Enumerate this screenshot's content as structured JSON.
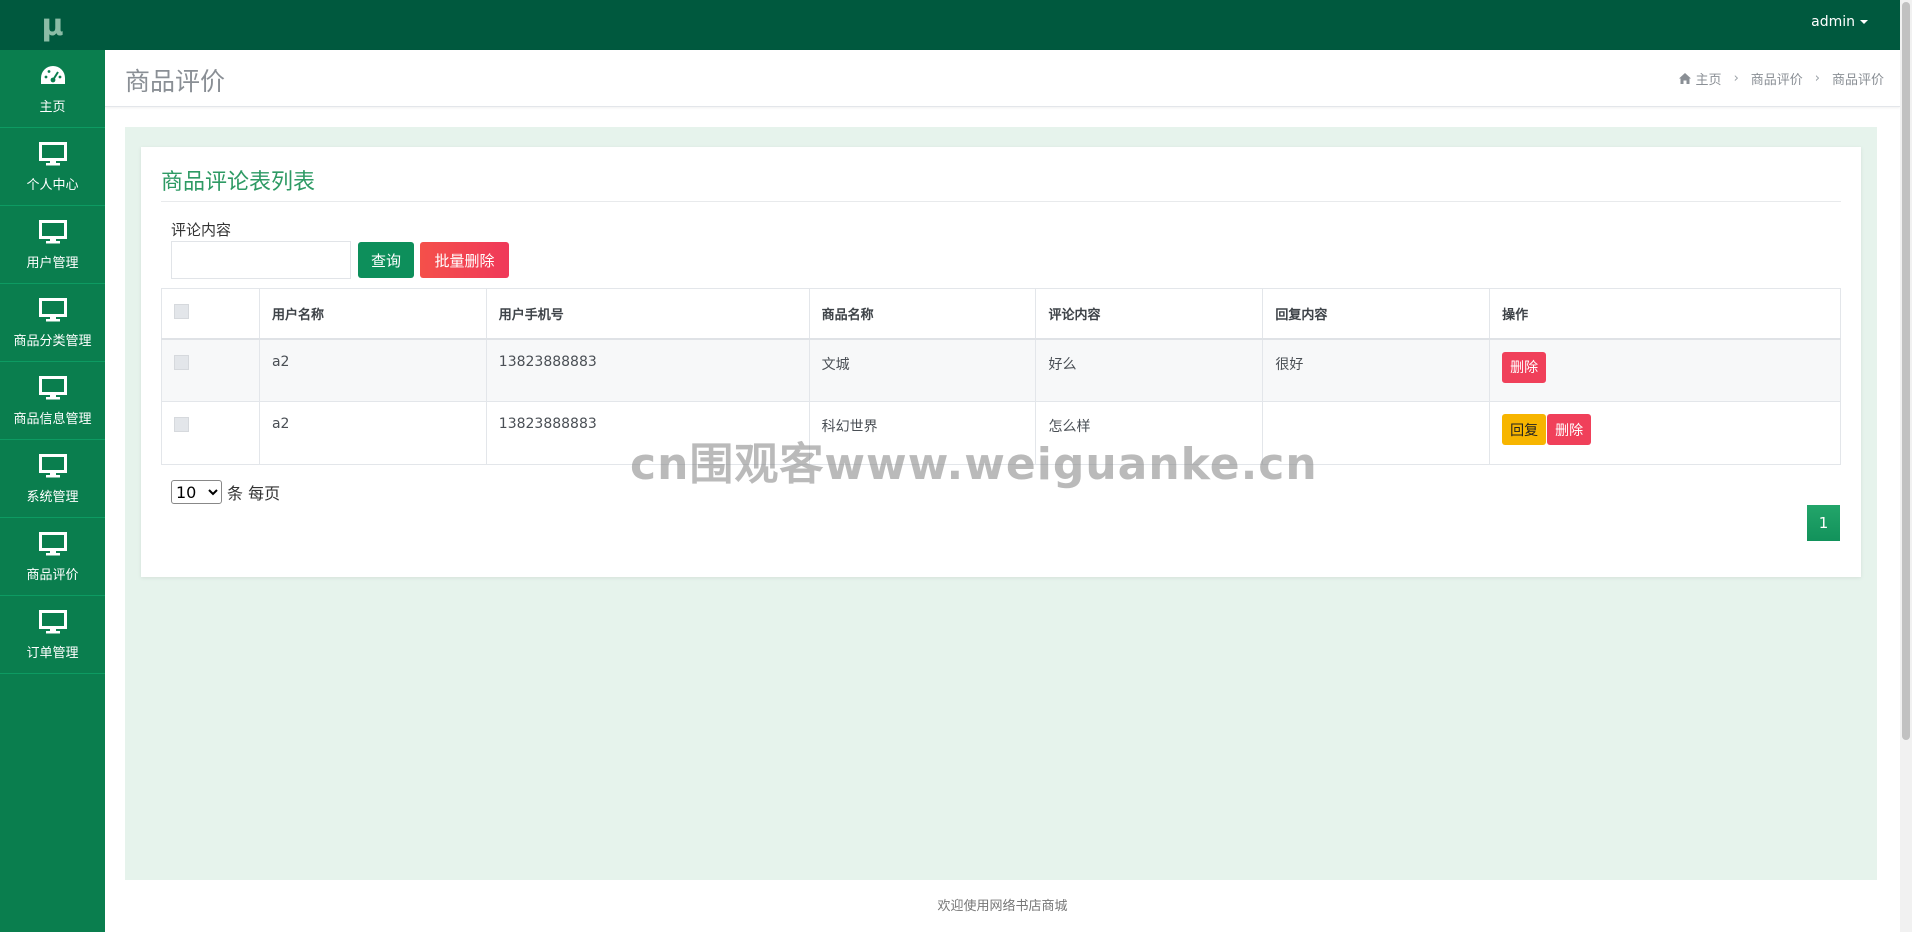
{
  "app": {
    "logo_text": "μ",
    "user_menu_label": "admin"
  },
  "sidebar": {
    "items": [
      {
        "label": "主页",
        "icon": "dashboard-icon"
      },
      {
        "label": "个人中心",
        "icon": "monitor-icon"
      },
      {
        "label": "用户管理",
        "icon": "monitor-icon"
      },
      {
        "label": "商品分类管理",
        "icon": "monitor-icon"
      },
      {
        "label": "商品信息管理",
        "icon": "monitor-icon"
      },
      {
        "label": "系统管理",
        "icon": "monitor-icon"
      },
      {
        "label": "商品评价",
        "icon": "monitor-icon"
      },
      {
        "label": "订单管理",
        "icon": "monitor-icon"
      }
    ]
  },
  "header": {
    "title": "商品评价",
    "breadcrumb": [
      "主页",
      "商品评价",
      "商品评价"
    ]
  },
  "card": {
    "title": "商品评论表列表",
    "search_label": "评论内容",
    "search_value": "",
    "query_button": "查询",
    "batch_delete_button": "批量删除"
  },
  "table": {
    "columns": [
      "用户名称",
      "用户手机号",
      "商品名称",
      "评论内容",
      "回复内容",
      "操作"
    ],
    "rows": [
      {
        "user": "a2",
        "phone": "13823888883",
        "product": "文城",
        "comment": "好么",
        "reply": "很好",
        "actions": [
          "删除"
        ]
      },
      {
        "user": "a2",
        "phone": "13823888883",
        "product": "科幻世界",
        "comment": "怎么样",
        "reply": "",
        "actions": [
          "回复",
          "删除"
        ]
      }
    ]
  },
  "pagination": {
    "page_size": "10",
    "page_size_options": [
      "10"
    ],
    "per_page_text": "条 每页",
    "current_page": "1"
  },
  "footer": {
    "text": "欢迎使用网络书店商城"
  },
  "watermark": {
    "text": "cn围观客www.weiguanke.cn"
  },
  "colors": {
    "sidebar": "#0a7e4e",
    "topbar": "#00593e",
    "accent": "#2e9a64",
    "danger": "#f0405a",
    "warning": "#f7b500",
    "content_bg": "#e6f3ec"
  }
}
